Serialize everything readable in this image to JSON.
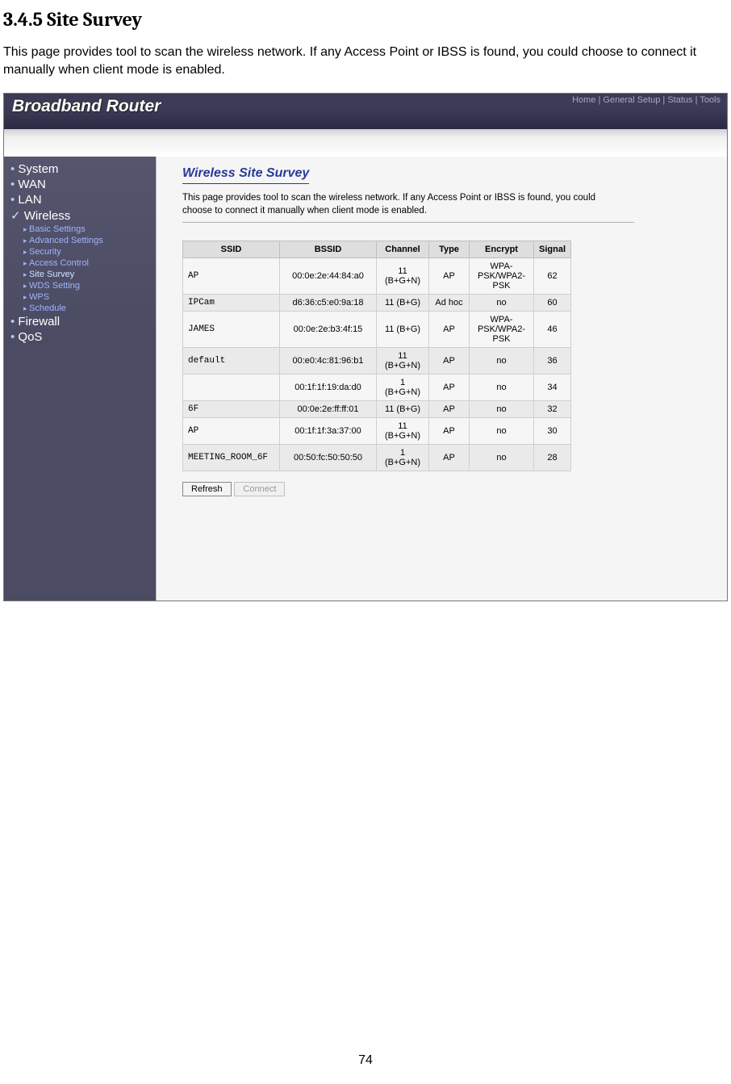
{
  "doc": {
    "heading": "3.4.5 Site Survey",
    "intro": "This page provides tool to scan the wireless network. If any Access Point or IBSS is found, you could choose to connect it manually when client mode is enabled.",
    "page_number": "74"
  },
  "header": {
    "brand": "Broadband Router",
    "nav": {
      "home": "Home",
      "general": "General Setup",
      "status": "Status",
      "tools": "Tools"
    }
  },
  "sidebar": {
    "system": "System",
    "wan": "WAN",
    "lan": "LAN",
    "wireless": "Wireless",
    "subs": {
      "basic": "Basic Settings",
      "advanced": "Advanced Settings",
      "security": "Security",
      "access": "Access Control",
      "site": "Site Survey",
      "wds": "WDS Setting",
      "wps": "WPS",
      "schedule": "Schedule"
    },
    "firewall": "Firewall",
    "qos": "QoS"
  },
  "content": {
    "title": "Wireless Site Survey",
    "desc": "This page provides tool to scan the wireless network. If any Access Point or IBSS is found, you could choose to connect it manually when client mode is enabled.",
    "columns": {
      "ssid": "SSID",
      "bssid": "BSSID",
      "channel": "Channel",
      "type": "Type",
      "encrypt": "Encrypt",
      "signal": "Signal"
    },
    "rows": [
      {
        "ssid": "   AP",
        "bssid": "00:0e:2e:44:84:a0",
        "channel": "11 (B+G+N)",
        "type": "AP",
        "encrypt": "WPA-PSK/WPA2-PSK",
        "signal": "62"
      },
      {
        "ssid": "IPCam",
        "bssid": "d6:36:c5:e0:9a:18",
        "channel": "11 (B+G)",
        "type": "Ad hoc",
        "encrypt": "no",
        "signal": "60"
      },
      {
        "ssid": "JAMES",
        "bssid": "00:0e:2e:b3:4f:15",
        "channel": "11 (B+G)",
        "type": "AP",
        "encrypt": "WPA-PSK/WPA2-PSK",
        "signal": "46"
      },
      {
        "ssid": "default",
        "bssid": "00:e0:4c:81:96:b1",
        "channel": "11 (B+G+N)",
        "type": "AP",
        "encrypt": "no",
        "signal": "36"
      },
      {
        "ssid": "",
        "bssid": "00:1f:1f:19:da:d0",
        "channel": "1 (B+G+N)",
        "type": "AP",
        "encrypt": "no",
        "signal": "34"
      },
      {
        "ssid": "6F",
        "bssid": "00:0e:2e:ff:ff:01",
        "channel": "11 (B+G)",
        "type": "AP",
        "encrypt": "no",
        "signal": "32"
      },
      {
        "ssid": "   AP",
        "bssid": "00:1f:1f:3a:37:00",
        "channel": "11 (B+G+N)",
        "type": "AP",
        "encrypt": "no",
        "signal": "30"
      },
      {
        "ssid": "MEETING_ROOM_6F",
        "bssid": "00:50:fc:50:50:50",
        "channel": "1 (B+G+N)",
        "type": "AP",
        "encrypt": "no",
        "signal": "28"
      }
    ],
    "buttons": {
      "refresh": "Refresh",
      "connect": "Connect"
    }
  }
}
